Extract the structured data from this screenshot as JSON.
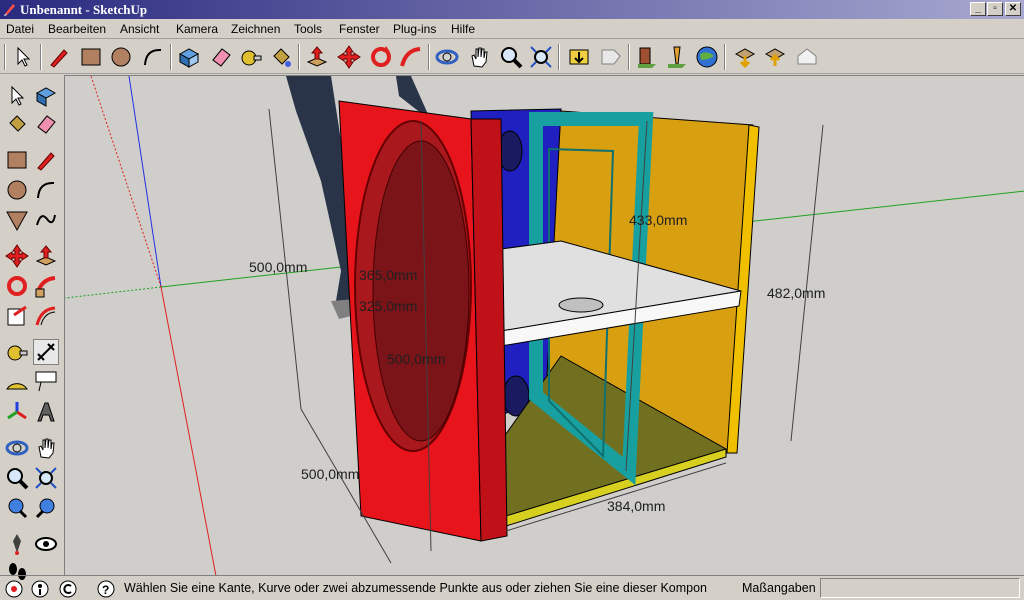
{
  "window": {
    "title": "Unbenannt - SketchUp"
  },
  "menu": [
    "Datei",
    "Bearbeiten",
    "Ansicht",
    "Kamera",
    "Zeichnen",
    "Tools",
    "Fenster",
    "Plug-ins",
    "Hilfe"
  ],
  "toolbar_icons": [
    "select-icon",
    "pencil-icon",
    "rectangle-icon",
    "circle-icon",
    "arc-icon",
    "make-component-icon",
    "eraser-icon",
    "paint-bucket-icon",
    "push-pull-icon",
    "move-icon",
    "rotate-icon",
    "follow-me-icon",
    "orbit-icon",
    "pan-icon",
    "zoom-icon",
    "zoom-extents-icon",
    "get-models-icon",
    "share-model-icon",
    "place-component-icon",
    "toggle-terrain-icon",
    "google-earth-icon",
    "get-current-view-icon",
    "add-location-icon",
    "preview-icon"
  ],
  "viewport": {
    "dimensions": {
      "height_left": "500,0mm",
      "depth_left": "500,0mm",
      "width_front": "384,0mm",
      "height_right": "482,0mm",
      "inner_top": "433,0mm",
      "circle_1": "365,0mm",
      "circle_2": "325,0mm",
      "circle_3": "500,0mm"
    }
  },
  "status": {
    "hint": "Wählen Sie eine Kante, Kurve oder zwei abzumessende Punkte aus oder ziehen Sie eine dieser Kompon",
    "measure_label": "Maßangaben",
    "measure_value": ""
  },
  "colors": {
    "front_panel": "#e8141c",
    "back_panel": "#2020c0",
    "frame": "#18a0a0",
    "side_panel": "#d8a010",
    "floor": "#707020",
    "brace": "#e0e0e0"
  }
}
